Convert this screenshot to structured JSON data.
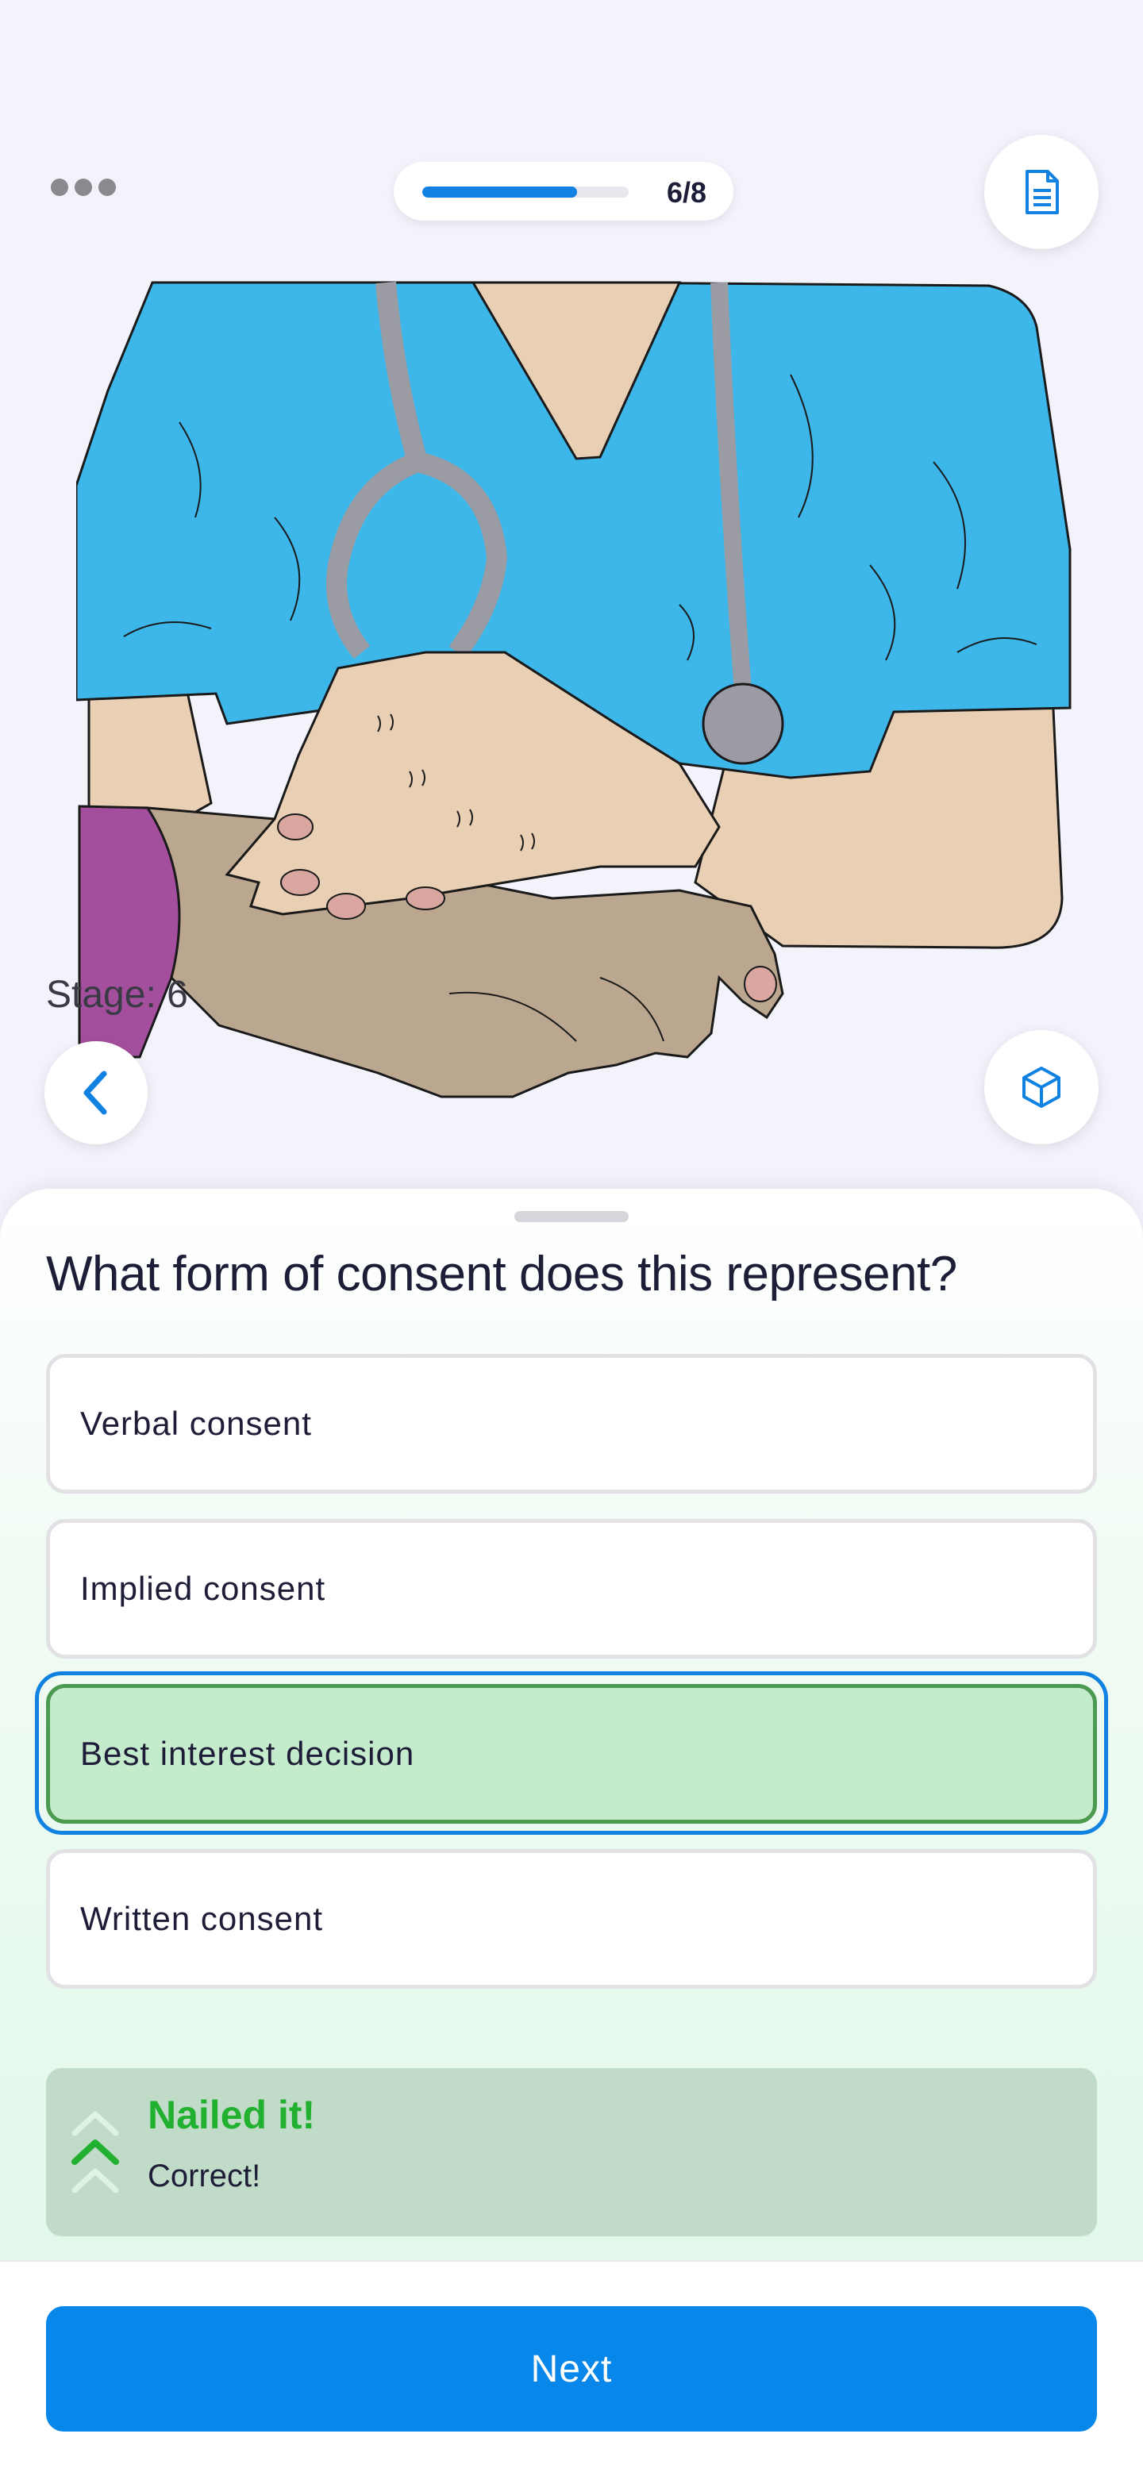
{
  "header": {
    "more_icon": "more-horizontal-icon",
    "progress": {
      "current": 6,
      "total": 8,
      "fraction": 0.75,
      "label": "6/8"
    },
    "doc_icon": "document-icon"
  },
  "stage": {
    "label": "Stage: 6"
  },
  "nav": {
    "back_icon": "chevron-left-icon",
    "model_icon": "cube-icon"
  },
  "question": {
    "text": "What form of consent does this represent?",
    "options": [
      {
        "label": "Verbal consent",
        "state": "default"
      },
      {
        "label": "Implied consent",
        "state": "default"
      },
      {
        "label": "Best interest decision",
        "state": "selected-correct"
      },
      {
        "label": "Written consent",
        "state": "default"
      }
    ]
  },
  "feedback": {
    "title": "Nailed it!",
    "message": "Correct!",
    "icon": "triple-chevron-up-icon"
  },
  "footer": {
    "next_label": "Next"
  },
  "colors": {
    "accent": "#1282E2",
    "correct_fill": "#C4EBCC",
    "correct_border": "#4B9A50",
    "feedback_bg": "#C0DBC8",
    "feedback_title": "#22B030",
    "scrubs": "#3DB6EA",
    "sleeve": "#A34F9E"
  }
}
